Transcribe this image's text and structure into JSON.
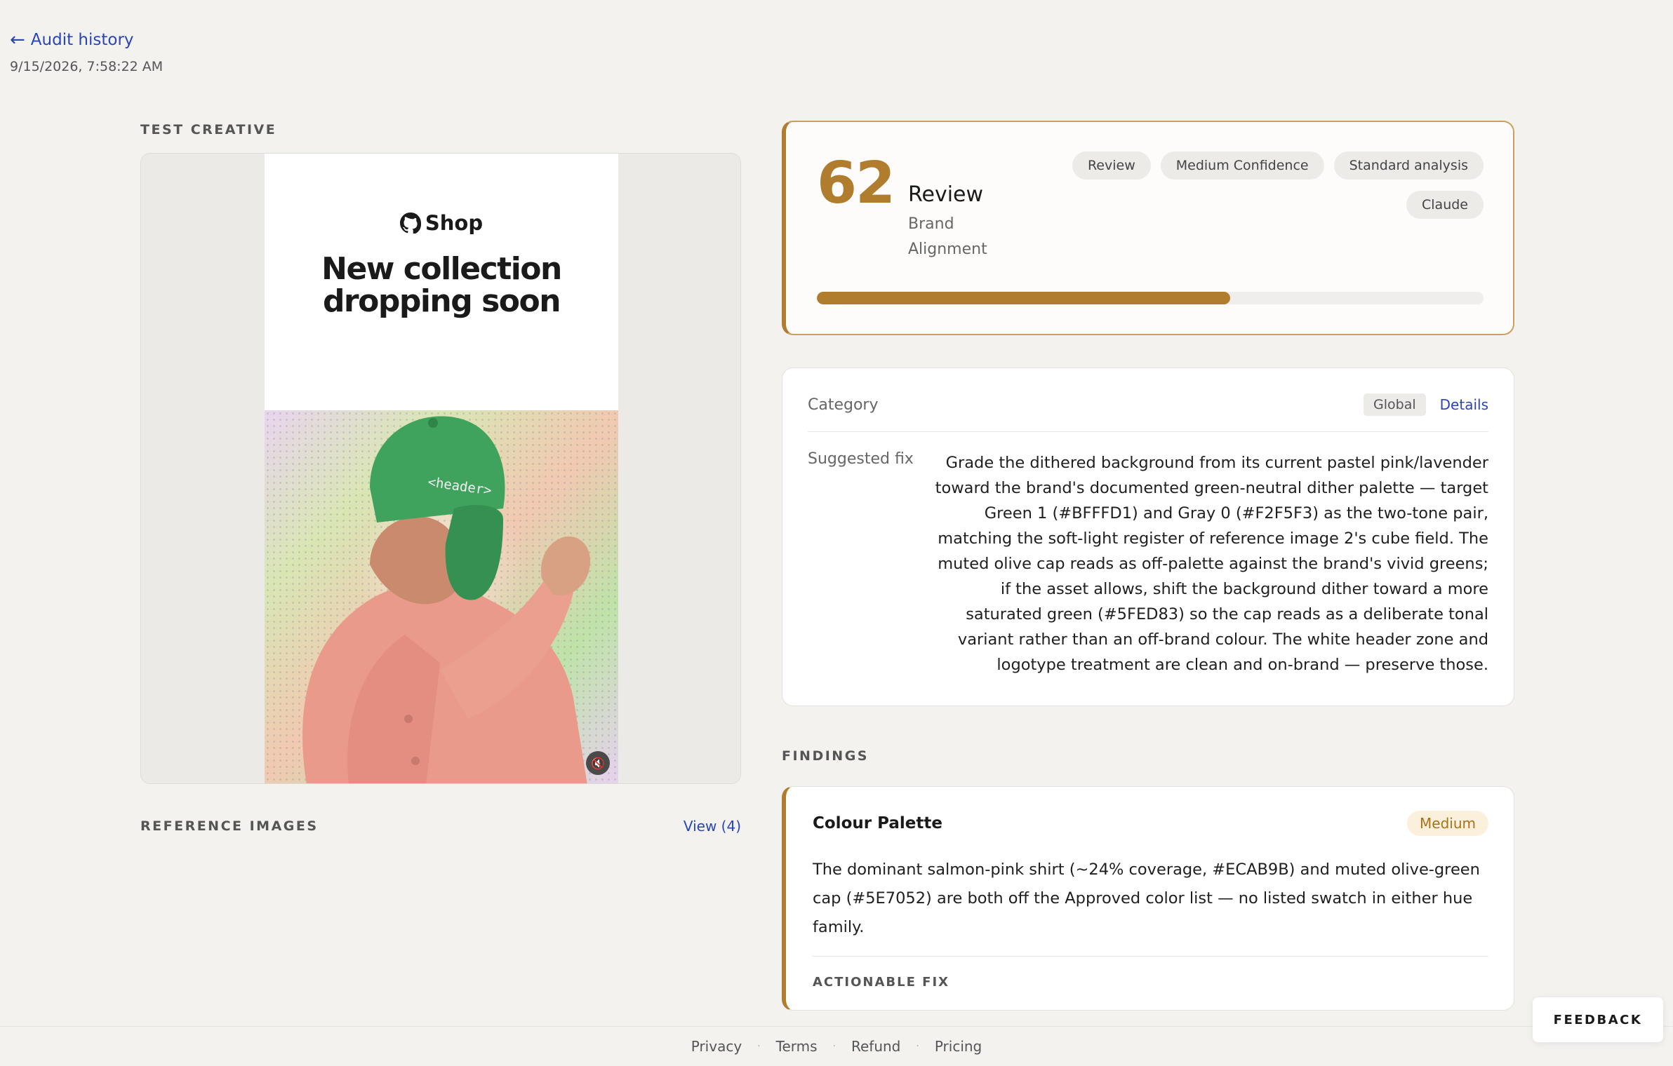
{
  "nav": {
    "back_label": "Audit history",
    "timestamp": "9/15/2026, 7:58:22 AM"
  },
  "left": {
    "test_creative_label": "TEST CREATIVE",
    "creative": {
      "brand_name": "Shop",
      "headline": "New collection dropping soon",
      "cap_text": "<header>"
    },
    "reference_label": "REFERENCE IMAGES",
    "view_label": "View (4)"
  },
  "score": {
    "value": "62",
    "status": "Review",
    "subtitle": "Brand Alignment",
    "badges": [
      "Review",
      "Medium Confidence",
      "Standard analysis",
      "Claude"
    ],
    "progress_percent": 62
  },
  "category": {
    "label": "Category",
    "chip": "Global",
    "details_label": "Details",
    "fix_label": "Suggested fix",
    "fix_text": "Grade the dithered background from its current pastel pink/lavender toward the brand's documented green-neutral dither palette — target Green 1 (#BFFFD1) and Gray 0 (#F2F5F3) as the two-tone pair, matching the soft-light register of reference image 2's cube field. The muted olive cap reads as off-palette against the brand's vivid greens; if the asset allows, shift the background dither toward a more saturated green (#5FED83) so the cap reads as a deliberate tonal variant rather than an off-brand colour. The white header zone and logotype treatment are clean and on-brand — preserve those."
  },
  "findings": {
    "label": "FINDINGS",
    "items": [
      {
        "title": "Colour Palette",
        "severity": "Medium",
        "body": "The dominant salmon-pink shirt (~24% coverage, #ECAB9B) and muted olive-green cap (#5E7052) are both off the Approved color list — no listed swatch in either hue family.",
        "actionable_label": "ACTIONABLE FIX"
      }
    ]
  },
  "footer": {
    "links": [
      "Privacy",
      "Terms",
      "Refund",
      "Pricing"
    ]
  },
  "feedback_label": "FEEDBACK",
  "colors": {
    "accent": "#b07d2e",
    "link": "#2a45b8",
    "background": "#f3f2ef"
  }
}
